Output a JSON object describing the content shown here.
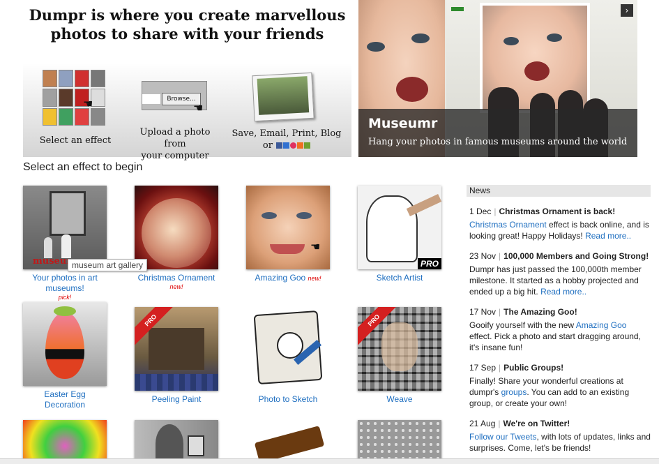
{
  "header": {
    "title_line1": "Dumpr is where you create marvellous",
    "title_line2": "photos to share with your friends",
    "steps": {
      "select": "Select an effect",
      "upload_line1": "Upload a photo from",
      "upload_line2": "your computer",
      "save_line1": "Save, Email, Print, Blog",
      "save_or": "or",
      "browse_label": "Browse..."
    }
  },
  "banner": {
    "title": "Museumr",
    "subtitle": "Hang your photos in famous museums around the world",
    "next_icon": "›"
  },
  "section_title": "Select an effect to begin",
  "tooltip": "museum art gallery",
  "effects": [
    {
      "name_line1": "Your photos in art",
      "name_line2": "museums!",
      "note": "pick!",
      "badge": "museumr"
    },
    {
      "name_line1": "Christmas Ornament",
      "note": "new!"
    },
    {
      "name_line1": "Amazing Goo",
      "note": "new!"
    },
    {
      "name_line1": "Sketch Artist",
      "badge": "PRO"
    },
    {
      "name_line1": "Easter Egg",
      "name_line2": "Decoration"
    },
    {
      "name_line1": "Peeling Paint",
      "badge": "PRO"
    },
    {
      "name_line1": "Photo to Sketch"
    },
    {
      "name_line1": "Weave",
      "badge": "PRO"
    }
  ],
  "news": {
    "heading": "News",
    "items": [
      {
        "date": "1 Dec",
        "title": "Christmas Ornament is back!",
        "link1": "Christmas Ornament",
        "text1": " effect is back online, and is looking great! Happy Holidays! ",
        "link2": "Read more.."
      },
      {
        "date": "23 Nov",
        "title": "100,000 Members and Going Strong!",
        "text0": "Dumpr has just passed the 100,000th member milestone. It started as a hobby projected and ended up a big hit. ",
        "link2": "Read more.."
      },
      {
        "date": "17 Nov",
        "title": "The Amazing Goo!",
        "text0": "Gooify yourself with the new ",
        "link1": "Amazing Goo",
        "text1": " effect. Pick a photo and start dragging around, it's insane fun!"
      },
      {
        "date": "17 Sep",
        "title": "Public Groups!",
        "text0": "Finally! Share your wonderful creations at dumpr's ",
        "link1": "groups",
        "text1": ". You can add to an existing group, or create your own!"
      },
      {
        "date": "21 Aug",
        "title": "We're on Twitter!",
        "link1": "Follow our Tweets",
        "text1": ", with lots of updates, links and surprises. Come, let's be friends!"
      }
    ]
  },
  "colors": {
    "link": "#1f6fc0",
    "note": "#dd0000",
    "pro": "#d42020"
  }
}
